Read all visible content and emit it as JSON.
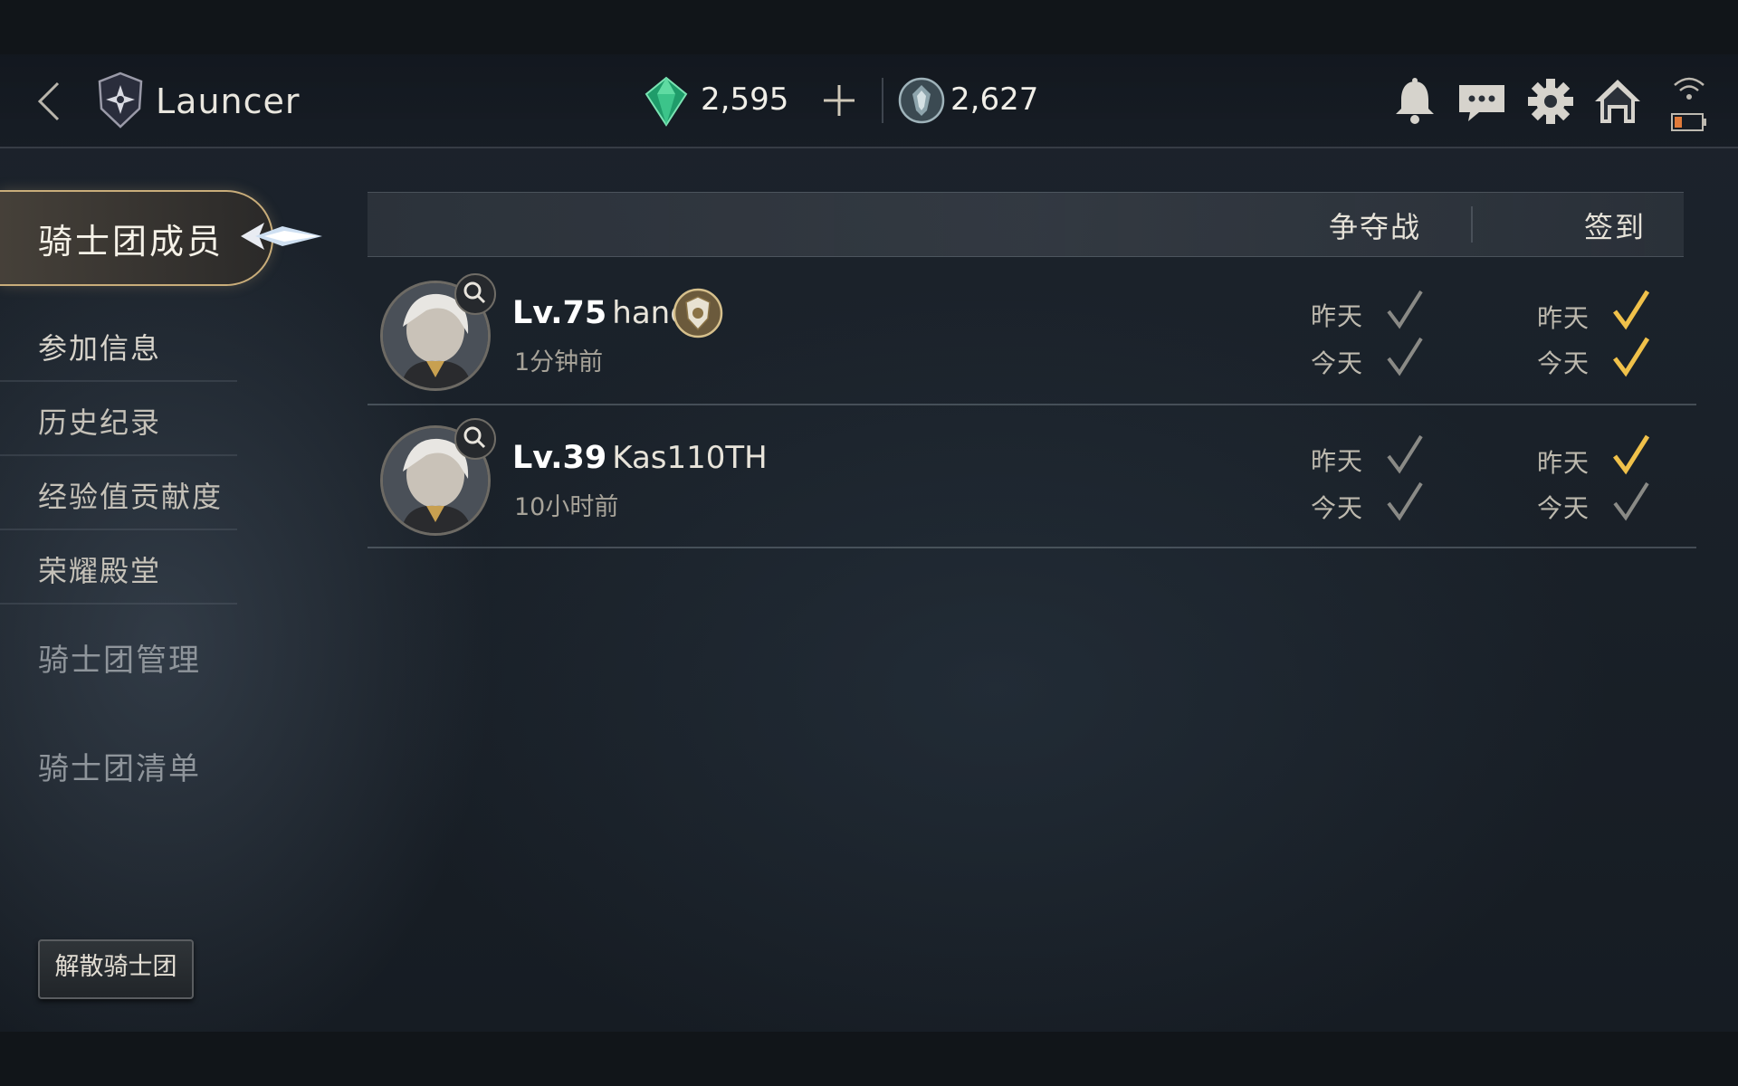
{
  "header": {
    "title": "Launcer",
    "currencies": [
      {
        "icon": "green-gem-icon",
        "value": "2,595"
      },
      {
        "icon": "silver-crest-icon",
        "value": "2,627"
      }
    ],
    "toolbar_icons": [
      "bell-icon",
      "chat-icon",
      "gear-icon",
      "home-icon"
    ]
  },
  "sidebar": {
    "active": "骑士团成员",
    "items": [
      {
        "label": "参加信息"
      },
      {
        "label": "历史纪录"
      },
      {
        "label": "经验值贡献度"
      },
      {
        "label": "荣耀殿堂"
      }
    ],
    "sections": [
      {
        "label": "骑士团管理"
      },
      {
        "label": "骑士团清单"
      }
    ],
    "disband_label": "解散骑士团"
  },
  "table": {
    "columns": [
      "争夺战",
      "签到"
    ],
    "check_labels": {
      "yesterday": "昨天",
      "today": "今天"
    },
    "rows": [
      {
        "level": "Lv.75",
        "name": "hand",
        "has_badge": true,
        "last_seen": "1分钟前",
        "battle": {
          "yesterday": false,
          "today": false
        },
        "checkin": {
          "yesterday": true,
          "today": true
        }
      },
      {
        "level": "Lv.39",
        "name": "Kas110TH",
        "has_badge": false,
        "last_seen": "10小时前",
        "battle": {
          "yesterday": false,
          "today": false
        },
        "checkin": {
          "yesterday": true,
          "today": false
        }
      }
    ]
  },
  "colors": {
    "accent_gold": "#f0c14a",
    "check_gray": "#8a8a86",
    "frame_gold": "#c9ad7a"
  }
}
